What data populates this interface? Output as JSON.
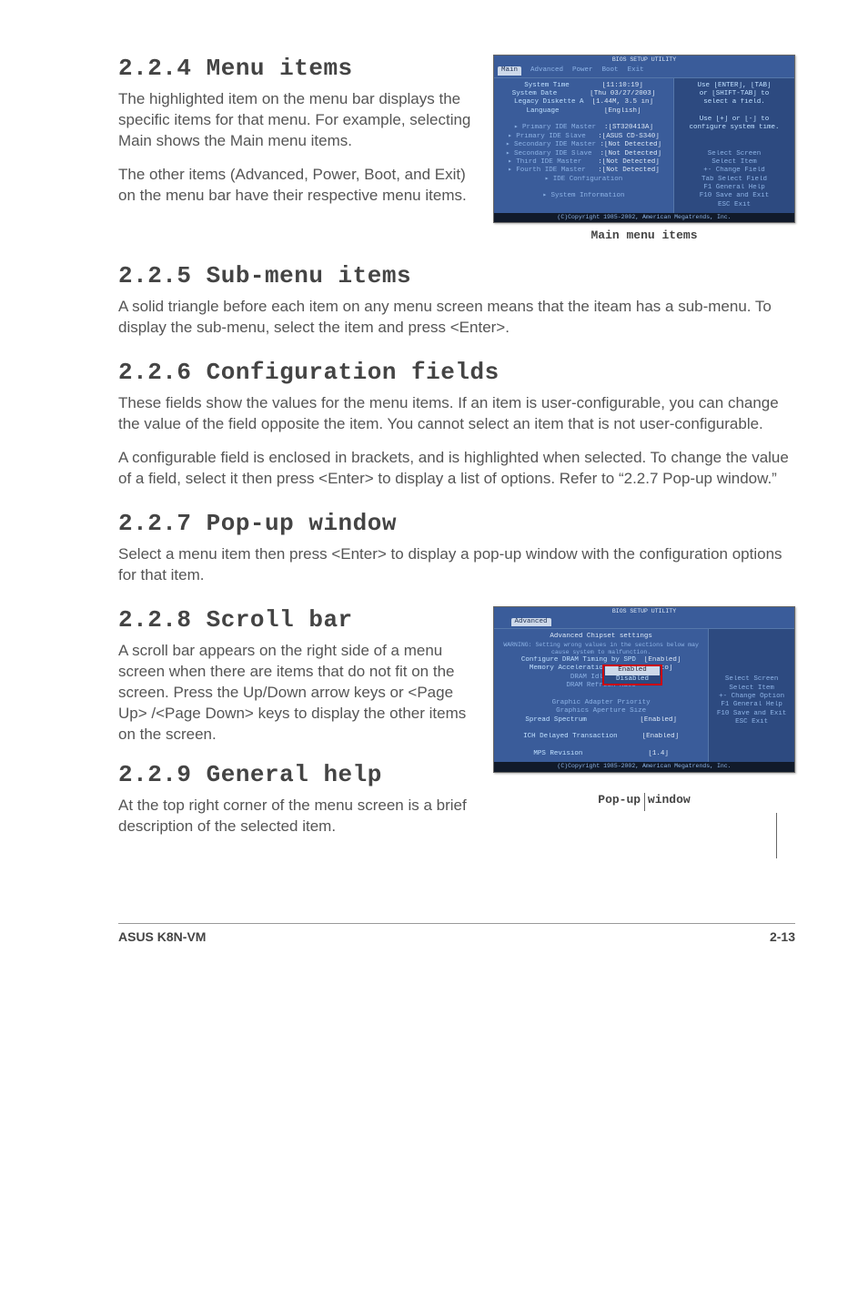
{
  "sections": {
    "s224": {
      "num": "2.2.4",
      "title": "Menu items",
      "p1": "The highlighted item on the menu bar displays the specific items for that menu. For example, selecting Main shows the Main menu items.",
      "p2": "The other items (Advanced, Power, Boot, and Exit) on the menu bar have their respective menu items."
    },
    "s225": {
      "num": "2.2.5",
      "title": "Sub-menu items",
      "p1": "A solid triangle before each item on any menu screen means that the iteam has a sub-menu. To display the sub-menu, select the item and press <Enter>."
    },
    "s226": {
      "num": "2.2.6",
      "title": "Configuration fields",
      "p1": "These fields show the values for the menu items. If an item is user-configurable, you can change the value of the field opposite the item. You cannot select an item that is not user-configurable.",
      "p2": "A configurable field is enclosed in brackets, and is highlighted when selected. To change the value of a field, select it then press <Enter> to display a list of options. Refer to “2.2.7 Pop-up window.”"
    },
    "s227": {
      "num": "2.2.7",
      "title": "Pop-up window",
      "p1": "Select a menu item then press <Enter> to display a pop-up window with the configuration options for that item."
    },
    "s228": {
      "num": "2.2.8",
      "title": "Scroll bar",
      "p1": "A scroll bar appears on the right side of a menu screen when there are items that do not fit on the screen. Press the Up/Down arrow keys or <Page Up> /<Page Down> keys to display the other items on the screen."
    },
    "s229": {
      "num": "2.2.9",
      "title": "General help",
      "p1": "At the top right corner of the menu screen is a brief description of the selected item."
    }
  },
  "fig1": {
    "caption": "Main menu items",
    "tabs": {
      "t1": "Main",
      "t2": "Advanced",
      "t3": "Power",
      "t4": "Boot",
      "t5": "Exit"
    },
    "utility_title": "BIOS SETUP UTILITY",
    "left": {
      "l1k": "System Time",
      "l1v": "[11:10:19]",
      "l2k": "System Date",
      "l2v": "[Thu 03/27/2003]",
      "l3k": "Legacy Diskette A",
      "l3v": "[1.44M, 3.5 in]",
      "l4k": "Language",
      "l4v": "[English]",
      "l5k": "Primary IDE Master",
      "l5v": ":[ST320413A]",
      "l6k": "Primary IDE Slave",
      "l6v": ":[ASUS CD-S340]",
      "l7k": "Secondary IDE Master",
      "l7v": ":[Not Detected]",
      "l8k": "Secondary IDE Slave",
      "l8v": ":[Not Detected]",
      "l9k": "Third IDE Master",
      "l9v": ":[Not Detected]",
      "l10k": "Fourth IDE Master",
      "l10v": ":[Not Detected]",
      "l11k": "IDE Configuration",
      "l12k": "System Information"
    },
    "right": {
      "r1": "Use [ENTER], [TAB]",
      "r2": "or [SHIFT-TAB] to",
      "r3": "select a field.",
      "r4": "Use [+] or [-] to",
      "r5": "configure system time.",
      "nav1": "Select Screen",
      "nav2": "Select Item",
      "nav3": "+-   Change Field",
      "nav4": "Tab  Select Field",
      "nav5": "F1   General Help",
      "nav6": "F10  Save and Exit",
      "nav7": "ESC  Exit"
    },
    "foot": "(C)Copyright 1985-2002, American Megatrends, Inc."
  },
  "fig2": {
    "caption": "Pop-up window",
    "utility_title": "BIOS SETUP UTILITY",
    "tab": "Advanced",
    "header": "Advanced Chipset settings",
    "warn": "WARNING: Setting wrong values in the sections below may cause system to malfunction.",
    "left": {
      "l1k": "Configure DRAM Timing by SPD",
      "l1v": "[Enabled]",
      "l2k": "Memory Acceleration Mode",
      "l2v": "[Auto]",
      "l3k": "DRAM Idle Timer",
      "l3v": "",
      "l4k": "DRAM Refresh Rate",
      "l4v": "",
      "l5k": "Graphic Adapter Priority",
      "l5v": "",
      "l6k": "Graphics Aperture Size",
      "l6v": "",
      "l7k": "Spread Spectrum",
      "l7v": "[Enabled]",
      "l8k": "ICH Delayed Transaction",
      "l8v": "[Enabled]",
      "l9k": "MPS Revision",
      "l9v": "[1.4]"
    },
    "popup": {
      "o1": "Enabled",
      "o2": "Disabled"
    },
    "right": {
      "nav1": "Select Screen",
      "nav2": "Select Item",
      "nav3": "+-   Change Option",
      "nav4": "F1   General Help",
      "nav5": "F10  Save and Exit",
      "nav6": "ESC  Exit"
    },
    "foot": "(C)Copyright 1985-2002, American Megatrends, Inc."
  },
  "footer": {
    "left": "ASUS K8N-VM",
    "right": "2-13"
  }
}
